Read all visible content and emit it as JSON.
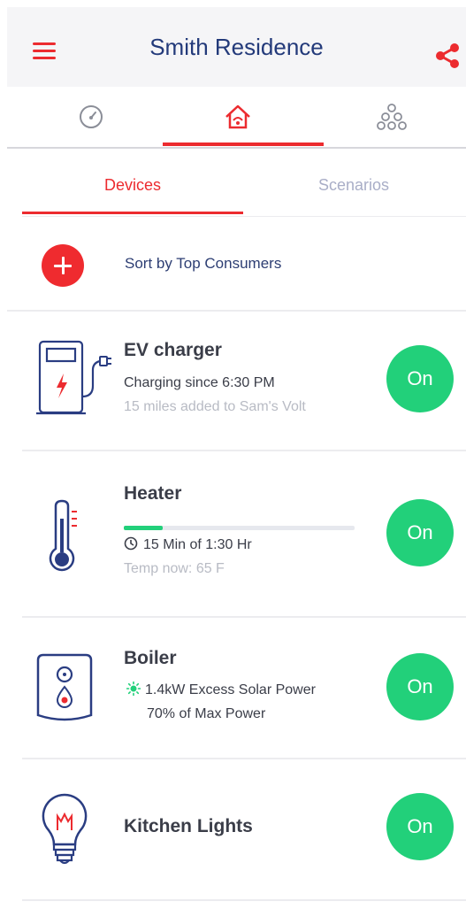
{
  "header": {
    "title": "Smith Residence",
    "menu_icon": "hamburger-menu-icon",
    "share_icon": "share-icon"
  },
  "top_tabs": [
    {
      "icon": "gauge-icon",
      "active": false
    },
    {
      "icon": "smart-home-icon",
      "active": true
    },
    {
      "icon": "network-hierarchy-icon",
      "active": false
    }
  ],
  "sub_tabs": {
    "devices": "Devices",
    "scenarios": "Scenarios",
    "active": "devices"
  },
  "sort": {
    "label": "Sort by Top Consumers",
    "add_icon": "plus-icon"
  },
  "devices": [
    {
      "name": "EV charger",
      "line1": "Charging since 6:30 PM",
      "line2": "15 miles added to Sam's Volt",
      "button": "On",
      "icon": "ev-charger-icon"
    },
    {
      "name": "Heater",
      "progress": 0.17,
      "line1": "15 Min of 1:30 Hr",
      "line2": "Temp now: 65 F",
      "button": "On",
      "icon": "thermometer-icon"
    },
    {
      "name": "Boiler",
      "line1": "1.4kW Excess Solar Power",
      "line2": "70% of Max Power",
      "button": "On",
      "icon": "boiler-icon"
    },
    {
      "name": "Kitchen Lights",
      "button": "On",
      "icon": "light-bulb-icon"
    }
  ],
  "colors": {
    "accent": "#ec2b2f",
    "on": "#22d07a",
    "title": "#233a7a",
    "line_art": "#2a3d82"
  }
}
